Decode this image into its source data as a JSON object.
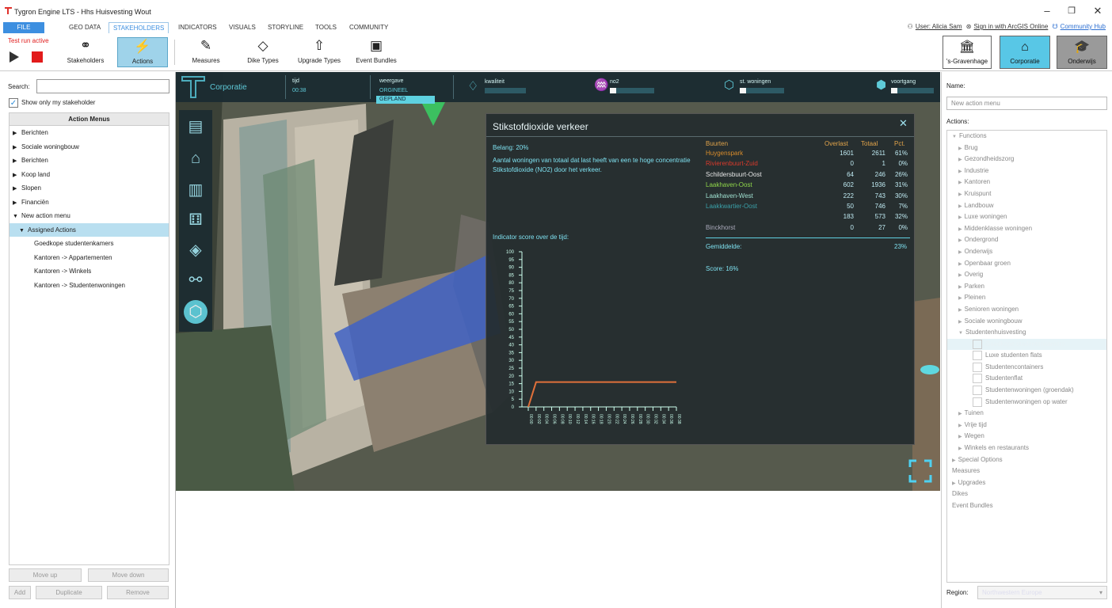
{
  "window": {
    "title": "Tygron Engine LTS - Hhs Huisvesting Wout"
  },
  "menu": {
    "file": "FILE",
    "tabs": [
      "GEO DATA",
      "STAKEHOLDERS",
      "INDICATORS",
      "VISUALS",
      "STORYLINE",
      "TOOLS",
      "COMMUNITY"
    ],
    "selected": "STAKEHOLDERS"
  },
  "toplinks": {
    "user": "User: Alicia Sam",
    "arcgis": "Sign in with ArcGIS Online",
    "hub": "Community Hub"
  },
  "ribbon": {
    "test_run": "Test run active",
    "buttons": [
      {
        "label": "Stakeholders",
        "icon": "stakeholders-icon"
      },
      {
        "label": "Actions",
        "icon": "actions-icon"
      },
      {
        "label": "Measures",
        "icon": "measures-icon"
      },
      {
        "label": "Dike Types",
        "icon": "dike-icon"
      },
      {
        "label": "Upgrade Types",
        "icon": "upgrade-icon"
      },
      {
        "label": "Event Bundles",
        "icon": "event-bundle-icon"
      }
    ],
    "stakeholders": [
      "'s-Gravenhage",
      "Corporatie",
      "Onderwijs"
    ]
  },
  "left": {
    "search_label": "Search:",
    "show_only": "Show only my stakeholder",
    "tree_header": "Action Menus",
    "nodes": [
      {
        "label": "Berichten",
        "open": false
      },
      {
        "label": "Sociale woningbouw",
        "open": false
      },
      {
        "label": "Berichten",
        "open": false
      },
      {
        "label": "Koop land",
        "open": false
      },
      {
        "label": "Slopen",
        "open": false
      },
      {
        "label": "Financiën",
        "open": false
      },
      {
        "label": "New action menu",
        "open": true
      },
      {
        "label": "Assigned Actions",
        "open": true
      }
    ],
    "leaves": [
      "Goedkope studentenkamers",
      "Kantoren -> Appartementen",
      "Kantoren -> Winkels",
      "Kantoren -> Studentenwoningen"
    ],
    "buttons": {
      "move_up": "Move up",
      "move_down": "Move down",
      "add": "Add",
      "duplicate": "Duplicate",
      "remove": "Remove"
    }
  },
  "hud": {
    "stakeholder": "Corporatie",
    "tijd_label": "tijd",
    "tijd_value": "00:38",
    "weergave_label": "weergave",
    "orgineel": "ORGINEEL",
    "gepland": "GEPLAND",
    "indicators": [
      {
        "label": "kwaliteit",
        "progress": 0.0
      },
      {
        "label": "no2",
        "progress": 0.15
      },
      {
        "label": "st. woningen",
        "progress": 0.15
      },
      {
        "label": "voortgang",
        "progress": 0.15
      }
    ]
  },
  "popup": {
    "title": "Stikstofdioxide verkeer",
    "belang": "Belang: 20%",
    "description": "Aantal woningen van totaal dat last heeft van een te hoge concentratie Stikstofdioxide (NO2) door het verkeer.",
    "chart_title": "Indicator score over de tijd:",
    "table_headers": [
      "Buurten",
      "Overlast",
      "Totaal",
      "Pct."
    ],
    "rows": [
      {
        "name": "Huygenspark",
        "overlast": "1601",
        "totaal": "2611",
        "pct": "61%",
        "color": "#d98c2b"
      },
      {
        "name": "Rivierenbuurt-Zuid",
        "overlast": "0",
        "totaal": "1",
        "pct": "0%",
        "color": "#d93a2b"
      },
      {
        "name": "Schildersbuurt-Oost",
        "overlast": "64",
        "totaal": "246",
        "pct": "26%",
        "color": "#e6e6e6"
      },
      {
        "name": "Laakhaven-Oost",
        "overlast": "602",
        "totaal": "1936",
        "pct": "31%",
        "color": "#8fd64a"
      },
      {
        "name": "Laakhaven-West",
        "overlast": "222",
        "totaal": "743",
        "pct": "30%",
        "color": "#9fe0d0"
      },
      {
        "name": "Laakkwartier-Oost",
        "overlast": "50",
        "totaal": "746",
        "pct": "7%",
        "color": "#3aa0a8"
      },
      {
        "name": "",
        "overlast": "183",
        "totaal": "573",
        "pct": "32%",
        "color": "#c0392b"
      },
      {
        "name": "Binckhorst",
        "overlast": "0",
        "totaal": "27",
        "pct": "0%",
        "color": "#aab"
      }
    ],
    "gemiddelde_label": "Gemiddelde:",
    "gemiddelde_value": "23%",
    "score": "Score: 16%"
  },
  "chart_data": {
    "type": "line",
    "title": "Indicator score over de tijd:",
    "ylim": [
      0,
      100
    ],
    "yticks": [
      0,
      5,
      10,
      15,
      20,
      25,
      30,
      35,
      40,
      45,
      50,
      55,
      60,
      65,
      70,
      75,
      80,
      85,
      90,
      95,
      100
    ],
    "x": [
      "00:00",
      "00:02",
      "00:04",
      "00:06",
      "00:08",
      "00:10",
      "00:12",
      "00:14",
      "00:16",
      "00:18",
      "00:20",
      "00:22",
      "00:24",
      "00:26",
      "00:28",
      "00:30",
      "00:32",
      "00:34",
      "00:36",
      "00:38"
    ],
    "series": [
      {
        "values": [
          0,
          16,
          16,
          16,
          16,
          16,
          16,
          16,
          16,
          16,
          16,
          16,
          16,
          16,
          16,
          16,
          16,
          16,
          16,
          16
        ],
        "color": "#e0703a"
      }
    ]
  },
  "right": {
    "name_label": "Name:",
    "name_value": "New action menu",
    "actions_label": "Actions:",
    "items": [
      {
        "label": "Functions",
        "level": 0,
        "tri": true
      },
      {
        "label": "Brug",
        "level": 1,
        "tri": true
      },
      {
        "label": "Gezondheidszorg",
        "level": 1,
        "tri": true
      },
      {
        "label": "Industrie",
        "level": 1,
        "tri": true
      },
      {
        "label": "Kantoren",
        "level": 1,
        "tri": true
      },
      {
        "label": "Kruispunt",
        "level": 1,
        "tri": true
      },
      {
        "label": "Landbouw",
        "level": 1,
        "tri": true
      },
      {
        "label": "Luxe woningen",
        "level": 1,
        "tri": true
      },
      {
        "label": "Middenklasse woningen",
        "level": 1,
        "tri": true
      },
      {
        "label": "Ondergrond",
        "level": 1,
        "tri": true
      },
      {
        "label": "Onderwijs",
        "level": 1,
        "tri": true
      },
      {
        "label": "Openbaar groen",
        "level": 1,
        "tri": true
      },
      {
        "label": "Overig",
        "level": 1,
        "tri": true
      },
      {
        "label": "Parken",
        "level": 1,
        "tri": true
      },
      {
        "label": "Pleinen",
        "level": 1,
        "tri": true
      },
      {
        "label": "Senioren woningen",
        "level": 1,
        "tri": true
      },
      {
        "label": "Sociale woningbouw",
        "level": 1,
        "tri": true
      },
      {
        "label": "Studentenhuisvesting",
        "level": 1,
        "tri": true
      },
      {
        "label": "Goedkope studentenkamers",
        "level": 2,
        "cb": true,
        "hi": true
      },
      {
        "label": "Luxe studenten flats",
        "level": 2,
        "cb": true
      },
      {
        "label": "Studentencontainers",
        "level": 2,
        "cb": true
      },
      {
        "label": "Studentenflat",
        "level": 2,
        "cb": true
      },
      {
        "label": "Studentenwoningen (groendak)",
        "level": 2,
        "cb": true
      },
      {
        "label": "Studentenwoningen op water",
        "level": 2,
        "cb": true
      },
      {
        "label": "Tuinen",
        "level": 1,
        "tri": true
      },
      {
        "label": "Vrije tijd",
        "level": 1,
        "tri": true
      },
      {
        "label": "Wegen",
        "level": 1,
        "tri": true
      },
      {
        "label": "Winkels en restaurants",
        "level": 1,
        "tri": true
      },
      {
        "label": "Special Options",
        "level": 0,
        "tri": true
      },
      {
        "label": "Measures",
        "level": 0,
        "tri": false
      },
      {
        "label": "Upgrades",
        "level": 0,
        "tri": true
      },
      {
        "label": "Dikes",
        "level": 0,
        "tri": false
      },
      {
        "label": "Event Bundles",
        "level": 0,
        "tri": false
      }
    ],
    "region_label": "Region:",
    "region_value": "Northwestern Europe"
  }
}
